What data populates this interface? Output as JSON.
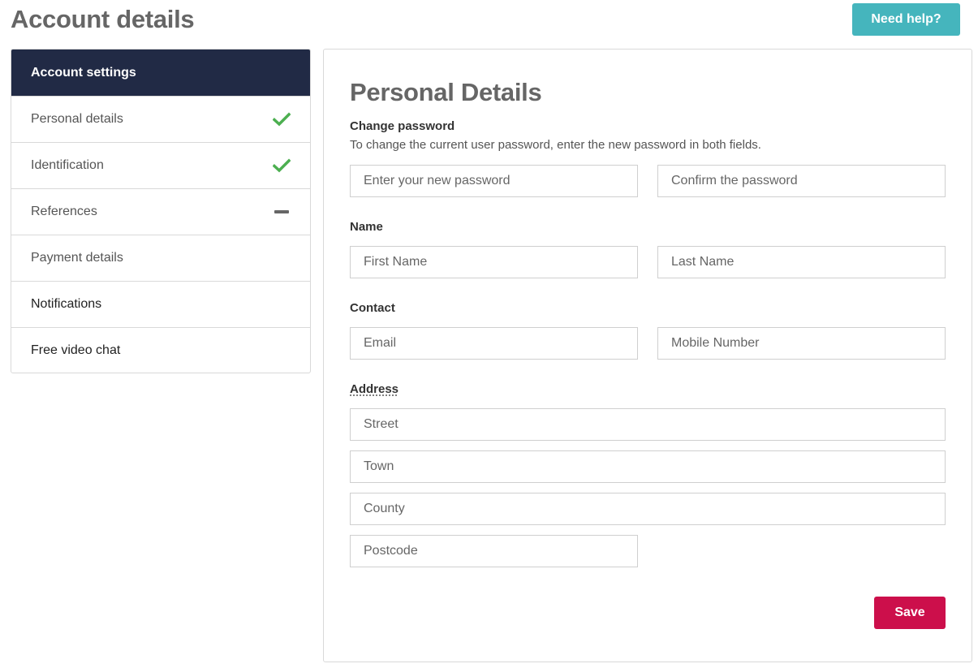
{
  "header": {
    "title": "Account details",
    "help_label": "Need help?"
  },
  "colors": {
    "help_button": "#45b5bd",
    "sidebar_header": "#212a45",
    "save_button": "#cc0f4b",
    "check": "#4caf50"
  },
  "sidebar": {
    "header": "Account settings",
    "items": [
      {
        "label": "Personal details",
        "status": "complete",
        "icon": "check-icon"
      },
      {
        "label": "Identification",
        "status": "complete",
        "icon": "check-icon"
      },
      {
        "label": "References",
        "status": "pending",
        "icon": "dash-icon"
      },
      {
        "label": "Payment details",
        "status": ""
      },
      {
        "label": "Notifications",
        "status": ""
      },
      {
        "label": "Free video chat",
        "status": ""
      }
    ]
  },
  "form": {
    "title": "Personal Details",
    "change_password": {
      "label": "Change password",
      "description": "To change the current user password, enter the new password in both fields.",
      "new_password_placeholder": "Enter your new password",
      "confirm_password_placeholder": "Confirm the password"
    },
    "name": {
      "label": "Name",
      "first_placeholder": "First Name",
      "last_placeholder": "Last Name"
    },
    "contact": {
      "label": "Contact",
      "email_placeholder": "Email",
      "mobile_placeholder": "Mobile Number"
    },
    "address": {
      "label": "Address",
      "street_placeholder": "Street",
      "town_placeholder": "Town",
      "county_placeholder": "County",
      "postcode_placeholder": "Postcode"
    },
    "save_label": "Save"
  }
}
